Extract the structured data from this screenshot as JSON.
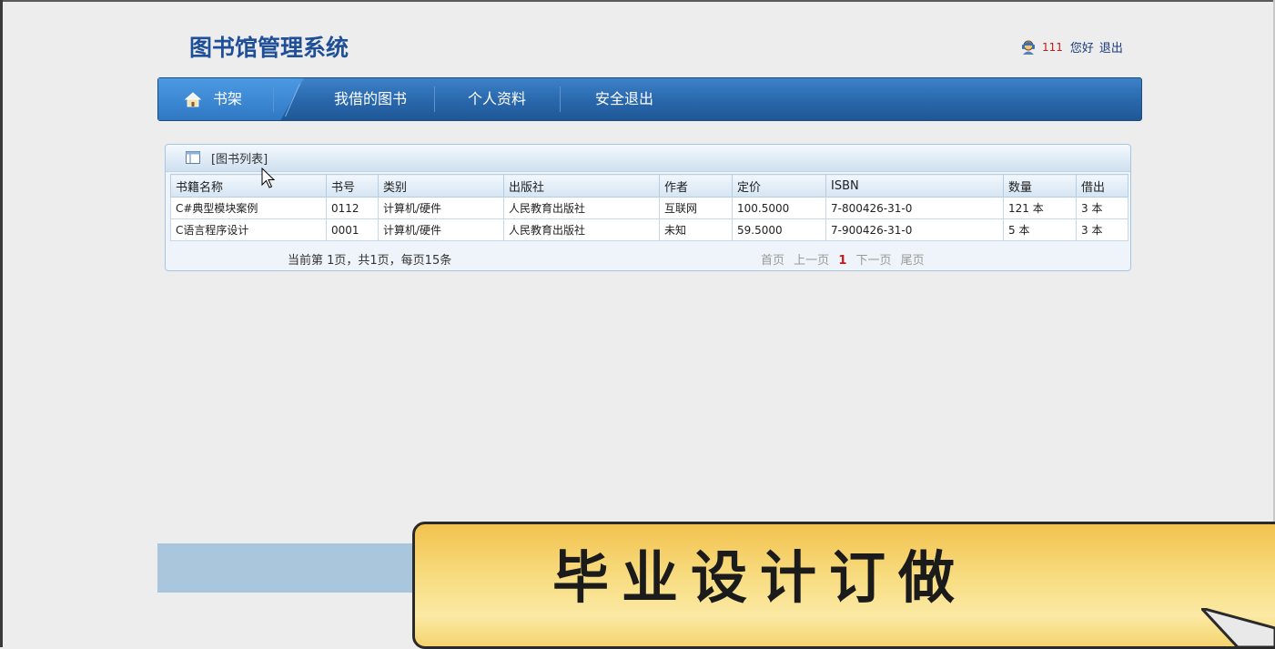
{
  "header": {
    "app_title": "图书馆管理系统",
    "user_name": "111",
    "greeting": "您好",
    "logout": "退出"
  },
  "nav": {
    "items": [
      {
        "label": "书架",
        "icon": "home-icon",
        "active": true
      },
      {
        "label": "我借的图书"
      },
      {
        "label": "个人资料"
      },
      {
        "label": "安全退出"
      }
    ]
  },
  "panel": {
    "title": "[图书列表]",
    "columns": [
      "书籍名称",
      "书号",
      "类别",
      "出版社",
      "作者",
      "定价",
      "ISBN",
      "数量",
      "借出"
    ],
    "rows": [
      [
        "C#典型模块案例",
        "0112",
        "计算机/硬件",
        "人民教育出版社",
        "互联网",
        "100.5000",
        "7-800426-31-0",
        "121 本",
        "3 本"
      ],
      [
        "C语言程序设计",
        "0001",
        "计算机/硬件",
        "人民教育出版社",
        "未知",
        "59.5000",
        "7-900426-31-0",
        "5 本",
        "3 本"
      ]
    ],
    "pager_info": "当前第 1页，共1页，每页15条",
    "pager": {
      "first": "首页",
      "prev": "上一页",
      "current": "1",
      "next": "下一页",
      "last": "尾页"
    }
  },
  "banner": {
    "text": "毕业设计订做"
  },
  "colors": {
    "title_blue": "#1f4f99",
    "nav_blue": "#2a69ae",
    "user_red": "#c21b1b",
    "banner_yellow": "#f8dd82"
  }
}
